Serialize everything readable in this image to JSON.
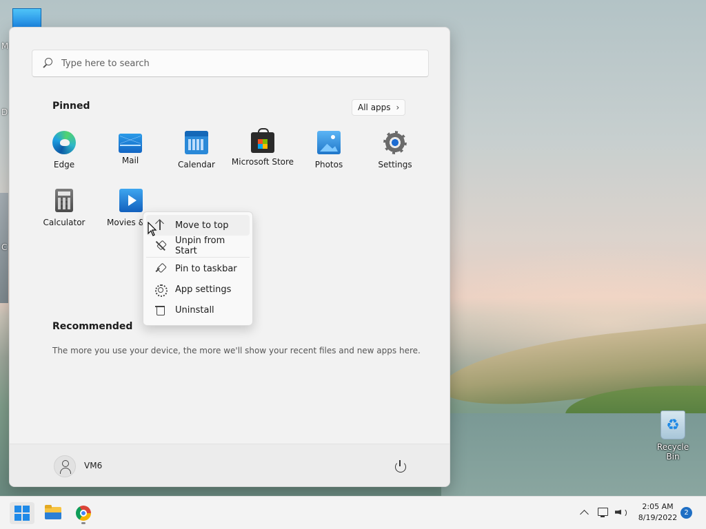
{
  "desktop": {
    "partial_labels": [
      "M",
      "D",
      "C"
    ],
    "recycle_bin_label": "Recycle Bin"
  },
  "start_menu": {
    "search": {
      "placeholder": "Type here to search",
      "value": ""
    },
    "pinned": {
      "title": "Pinned",
      "all_apps_label": "All apps",
      "apps": [
        {
          "label": "Edge",
          "icon": "edge-icon"
        },
        {
          "label": "Mail",
          "icon": "mail-icon"
        },
        {
          "label": "Calendar",
          "icon": "calendar-icon"
        },
        {
          "label": "Microsoft Store",
          "icon": "store-icon"
        },
        {
          "label": "Photos",
          "icon": "photos-icon"
        },
        {
          "label": "Settings",
          "icon": "settings-icon"
        },
        {
          "label": "Calculator",
          "icon": "calculator-icon"
        },
        {
          "label": "Movies &",
          "icon": "movies-icon"
        }
      ]
    },
    "recommended": {
      "title": "Recommended",
      "empty_text": "The more you use your device, the more we'll show your recent files and new apps here."
    },
    "user": {
      "name": "VM6"
    },
    "context_menu": {
      "items": [
        {
          "label": "Move to top",
          "icon": "arrow-up-icon"
        },
        {
          "label": "Unpin from Start",
          "icon": "unpin-icon"
        },
        {
          "label": "Pin to taskbar",
          "icon": "pin-icon"
        },
        {
          "label": "App settings",
          "icon": "gear-icon"
        },
        {
          "label": "Uninstall",
          "icon": "trash-icon"
        }
      ]
    }
  },
  "taskbar": {
    "apps": [
      "start",
      "file-explorer",
      "chrome"
    ],
    "clock": {
      "time": "2:05 AM",
      "date": "8/19/2022"
    },
    "notification_count": "2"
  },
  "colors": {
    "accent": "#1f6fc4",
    "menu_bg": "#f2f2f2",
    "taskbar_bg": "#f3f3f3"
  }
}
